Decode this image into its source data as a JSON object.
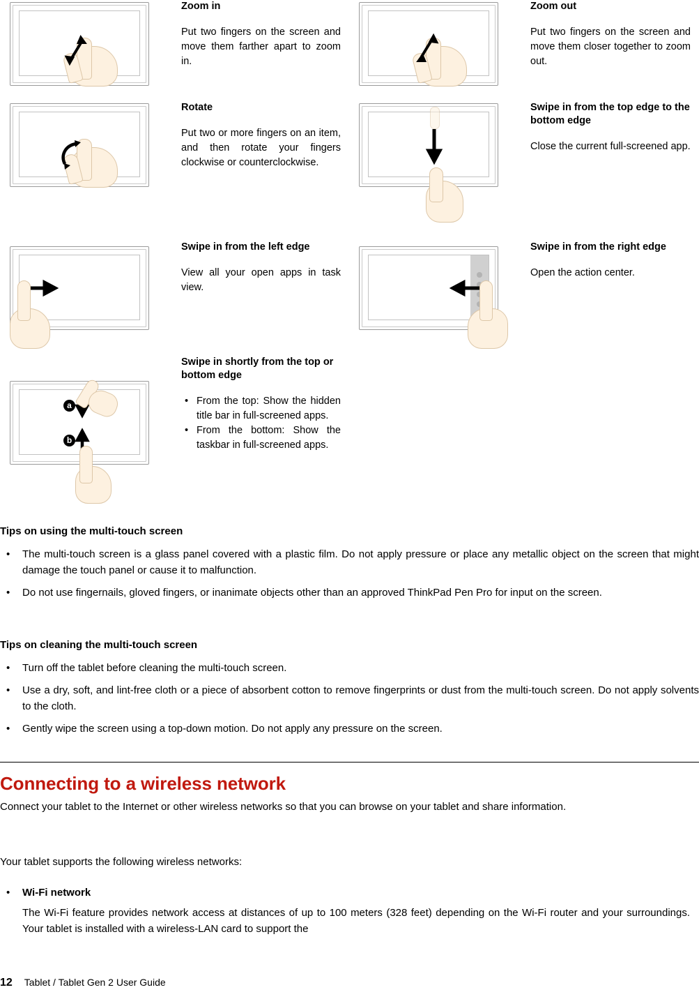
{
  "document": {
    "page_number": "12",
    "footer_text": "Tablet / Tablet Gen 2 User Guide"
  },
  "gestures": [
    {
      "id": "zoom-in",
      "title": "Zoom in",
      "desc": "Put two fingers on the screen and move them farther apart to zoom in.",
      "figure": "tablet-pinch-open-icon"
    },
    {
      "id": "zoom-out",
      "title": "Zoom out",
      "desc": "Put two fingers on the screen and move them closer together to zoom out.",
      "figure": "tablet-pinch-close-icon"
    },
    {
      "id": "rotate",
      "title": "Rotate",
      "desc": "Put two or more fingers on an item, and then rotate your fingers clockwise or counterclockwise.",
      "figure": "tablet-rotate-icon"
    },
    {
      "id": "swipe-top-to-bottom",
      "title": "Swipe in from the top edge to the bottom edge",
      "desc": "Close the current full-screened app.",
      "figure": "tablet-swipe-down-icon"
    },
    {
      "id": "swipe-left-edge",
      "title": "Swipe in from the left edge",
      "desc": "View all your open apps in task view.",
      "figure": "tablet-swipe-right-icon"
    },
    {
      "id": "swipe-right-edge",
      "title": "Swipe in from the right edge",
      "desc": "Open the action center.",
      "figure": "tablet-swipe-left-icon"
    },
    {
      "id": "swipe-shortly-top-bottom",
      "title": "Swipe in shortly from the top or bottom edge",
      "desc": "",
      "bullets": [
        "From the top:  Show the hidden title bar in full-screened apps.",
        "From the bottom: Show the taskbar in full-screened apps."
      ],
      "figure": "tablet-swipe-short-icon",
      "figure_markers": [
        "a",
        "b"
      ]
    }
  ],
  "tips_using": {
    "heading": "Tips on using the multi-touch screen",
    "items": [
      "The multi-touch screen is a glass panel covered with a plastic film.  Do not apply pressure or place any metallic object on the screen that might damage the touch panel or cause it to malfunction.",
      "Do not use fingernails, gloved fingers, or inanimate objects other than an approved ThinkPad Pen Pro for input on the screen."
    ]
  },
  "tips_cleaning": {
    "heading": "Tips on cleaning the multi-touch screen",
    "items": [
      "Turn off the tablet before cleaning the multi-touch screen.",
      "Use a dry, soft, and lint-free cloth or a piece of absorbent cotton to remove fingerprints or dust from the multi-touch screen.  Do not apply solvents to the cloth.",
      "Gently wipe the screen using a top-down motion.  Do not apply any pressure on the screen."
    ]
  },
  "wireless_section": {
    "heading": "Connecting to a wireless network",
    "heading_color": "#c0190f",
    "intro": "Connect your tablet to the Internet or other wireless networks so that you can browse on your tablet and share information.",
    "supports_line": "Your tablet supports the following wireless networks:",
    "network_label": "Wi-Fi network",
    "network_desc": "The Wi-Fi feature provides network access at distances of up to 100 meters (328 feet) depending on the Wi-Fi router and your surroundings.  Your tablet is installed with a wireless-LAN card to support the"
  }
}
